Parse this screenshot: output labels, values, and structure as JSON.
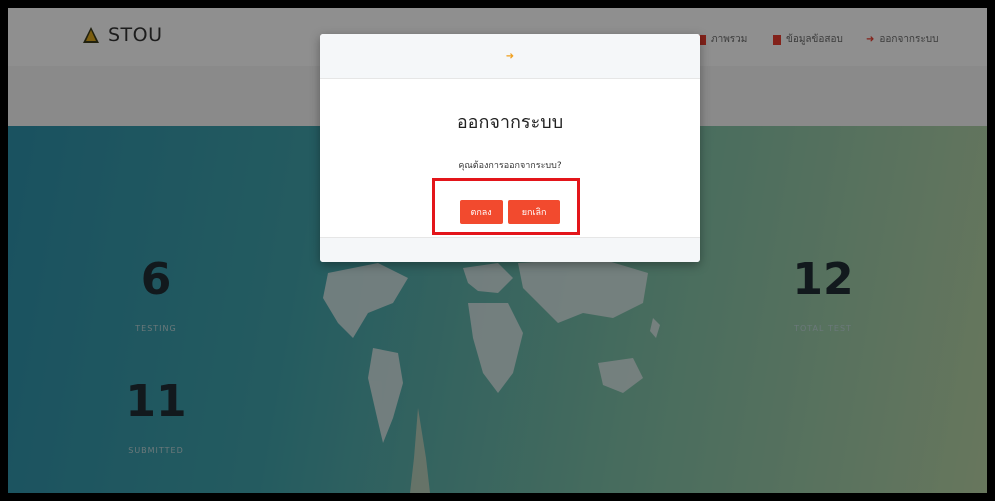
{
  "brand": {
    "name": "STOU",
    "icon": "mountain-logo-icon"
  },
  "nav": {
    "overview": "ภาพรวม",
    "exam_info": "ข้อมูลข้อสอบ",
    "logout": "ออกจากระบบ"
  },
  "stats": {
    "testing": {
      "value": "6",
      "label": "TESTING"
    },
    "total_test": {
      "value": "12",
      "label": "TOTAL TEST"
    },
    "submitted": {
      "value": "11",
      "label": "SUBMITTED"
    }
  },
  "modal": {
    "title": "ออกจากระบบ",
    "message": "คุณต้องการออกจากระบบ?",
    "confirm_label": "ตกลง",
    "cancel_label": "ยกเลิก",
    "header_icon": "logout-icon"
  },
  "colors": {
    "accent": "#f24a2e",
    "highlight": "#e3151a"
  }
}
